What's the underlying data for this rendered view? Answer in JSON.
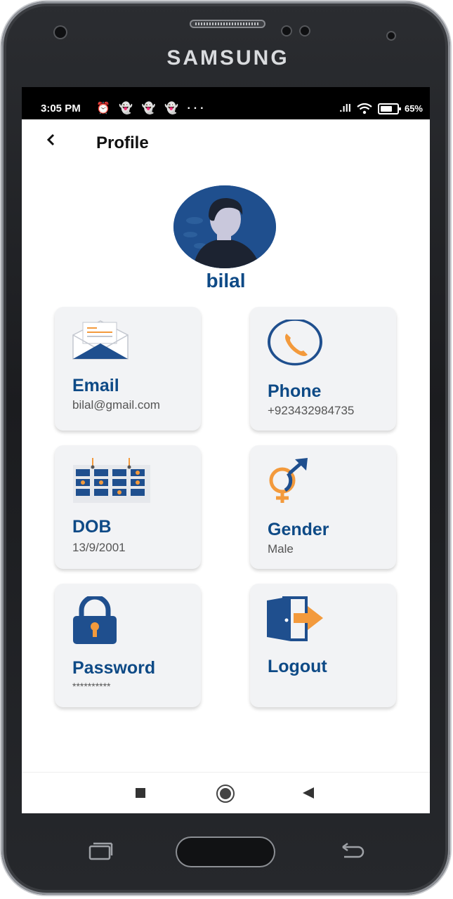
{
  "device": {
    "brand": "SAMSUNG"
  },
  "status_bar": {
    "time": "3:05 PM",
    "notification_icons": "⏰ 👻 👻 👻 ···",
    "signal": ".ıll",
    "battery": "65%"
  },
  "header": {
    "back_icon": "chevron-left-icon",
    "title": "Profile"
  },
  "profile": {
    "name": "bilal"
  },
  "cards": {
    "email": {
      "title": "Email",
      "value": "bilal@gmail.com"
    },
    "phone": {
      "title": "Phone",
      "value": "+923432984735"
    },
    "dob": {
      "title": "DOB",
      "value": "13/9/2001"
    },
    "gender": {
      "title": "Gender",
      "value": "Male"
    },
    "password": {
      "title": "Password",
      "value": "**********"
    },
    "logout": {
      "title": "Logout"
    }
  },
  "colors": {
    "accent": "#0e4a86",
    "card_bg": "#f2f3f5",
    "orange": "#f39a3c"
  }
}
